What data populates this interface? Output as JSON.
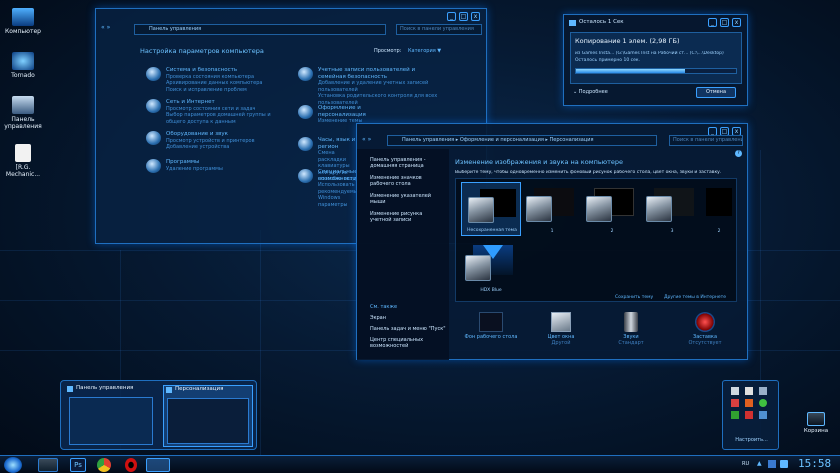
{
  "desktop": {
    "icons": [
      {
        "label": "Компьютер"
      },
      {
        "label": "Tornado"
      },
      {
        "label": "Панель управления"
      },
      {
        "label": "[R.G. Mechanic..."
      }
    ]
  },
  "control_panel": {
    "breadcrumb": "Панель управления",
    "search_placeholder": "Поиск в панели управления",
    "title": "Настройка параметров компьютера",
    "view_label": "Просмотр:",
    "view_value": "Категория ▼",
    "categories": [
      {
        "title": "Система и безопасность",
        "links": [
          "Проверка состояния компьютера",
          "Архивирование данных компьютера",
          "Поиск и исправление проблем"
        ]
      },
      {
        "title": "Сеть и Интернет",
        "links": [
          "Просмотр состояния сети и задач",
          "Выбор параметров домашней группы и общего доступа к данным"
        ]
      },
      {
        "title": "Оборудование и звук",
        "links": [
          "Просмотр устройств и принтеров",
          "Добавление устройства"
        ]
      },
      {
        "title": "Программы",
        "links": [
          "Удаление программы"
        ]
      },
      {
        "title": "Учетные записи пользователей и семейная безопасность",
        "links": [
          "Добавление и удаление учетных записей пользователей",
          "Установка родительского контроля для всех пользователей"
        ]
      },
      {
        "title": "Оформление и персонализация",
        "links": [
          "Изменение темы",
          "Изменение фонового рисунка рабочего стола",
          "Настройка разрешения экрана"
        ]
      },
      {
        "title": "Часы, язык и регион",
        "links": [
          "Смена раскладки клавиатуры или других способов ввода",
          "Изменение языка интерфейса"
        ]
      },
      {
        "title": "Специальные возможности",
        "links": [
          "Использовать рекомендуемые Windows параметры",
          "Оптимизация изображения на экране"
        ]
      }
    ]
  },
  "copy_dialog": {
    "title": "Осталось 1 Сек",
    "heading": "Копирование 1 элем. (2,98 ГБ)",
    "from_to": "из Games Insta... (G:\\Games Inst на Рабочий ст... (C:\\...\\Desktop)",
    "remaining": "Осталось примерно 10 сек.",
    "progress": 0.68,
    "details_label": "Подробнее",
    "cancel_label": "Отмена"
  },
  "personalization": {
    "breadcrumb": [
      "Панель управления",
      "Оформление и персонализация",
      "Персонализация"
    ],
    "search_placeholder": "Поиск в панели управления",
    "sidebar": [
      "Панель управления - домашняя страница",
      "Изменение значков рабочего стола",
      "Изменение указателей мыши",
      "Изменение рисунка учетной записи"
    ],
    "sidebar_see_also": "См. также",
    "sidebar_bottom": [
      "Экран",
      "Панель задач и меню \"Пуск\"",
      "Центр специальных возможностей"
    ],
    "heading": "Изменение изображения и звука на компьютере",
    "subheading": "Выберите тему, чтобы одновременно изменить фоновый рисунок рабочего стола, цвет окна, звуки и заставку.",
    "themes": [
      "Несохраненная тема",
      "1",
      "2",
      "3",
      "2",
      "HDX Blue"
    ],
    "save_theme": "Сохранить тему",
    "more_themes": "Другие темы в Интернете",
    "bottom": [
      {
        "label": "Фон рабочего стола",
        "sub": ""
      },
      {
        "label": "Цвет окна",
        "sub": "Другой"
      },
      {
        "label": "Звуки",
        "sub": "Стандарт"
      },
      {
        "label": "Заставка",
        "sub": "Отсутствует"
      }
    ]
  },
  "previews": {
    "items": [
      "Панель управления",
      "Персонализация"
    ]
  },
  "tray_popup": {
    "customize_label": "Настроить..."
  },
  "desktop_right_icon": {
    "label": "Корзина"
  },
  "taskbar": {
    "lang": "RU",
    "time": "15:58"
  }
}
